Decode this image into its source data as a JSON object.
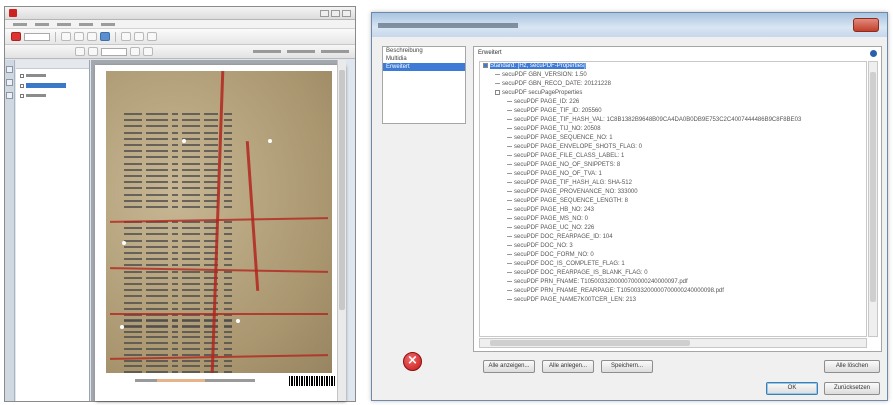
{
  "dialog": {
    "categories": [
      "Beschreibung",
      "Multidia",
      "Erweitert"
    ],
    "selected_category": "Erweitert",
    "panel_title": "Erweitert",
    "tree": [
      {
        "text": "Standard: [Hz, secuPDF-Properties]",
        "level": 0,
        "expander": true,
        "selected": true
      },
      {
        "text": "secuPDF GBN_VERSION: 1.50",
        "level": 1
      },
      {
        "text": "secuPDF GBN_RECO_DATE: 20121228",
        "level": 1
      },
      {
        "text": "secuPDF secuPageProperties",
        "level": 1,
        "expander": true
      },
      {
        "text": "secuPDF PAGE_ID: 226",
        "level": 2
      },
      {
        "text": "secuPDF PAGE_TIF_ID: 205560",
        "level": 2
      },
      {
        "text": "secuPDF PAGE_TIF_HASH_VAL: 1C8B1382B9648B09CA4DA0B0DB9E753C2C4007444486B9C8F8BE03",
        "level": 2
      },
      {
        "text": "secuPDF PAGE_TIJ_NO: 20508",
        "level": 2
      },
      {
        "text": "secuPDF PAGE_SEQUENCE_NO: 1",
        "level": 2
      },
      {
        "text": "secuPDF PAGE_ENVELOPE_SHOTS_FLAG: 0",
        "level": 2
      },
      {
        "text": "secuPDF PAGE_FILE_CLASS_LABEL: 1",
        "level": 2
      },
      {
        "text": "secuPDF PAGE_NO_OF_SNIPPETS: 8",
        "level": 2
      },
      {
        "text": "secuPDF PAGE_NO_OF_TVA: 1",
        "level": 2
      },
      {
        "text": "secuPDF PAGE_TIF_HASH_ALG: SHA-512",
        "level": 2
      },
      {
        "text": "secuPDF PAGE_PROVENANCE_NO: 333000",
        "level": 2
      },
      {
        "text": "secuPDF PAGE_SEQUENCE_LENGTH: 8",
        "level": 2
      },
      {
        "text": "secuPDF PAGE_HB_NO: 243",
        "level": 2
      },
      {
        "text": "secuPDF PAGE_MS_NO: 0",
        "level": 2
      },
      {
        "text": "secuPDF PAGE_UC_NO: 226",
        "level": 2
      },
      {
        "text": "secuPDF DOC_REARPAGE_ID: 104",
        "level": 2
      },
      {
        "text": "secuPDF DOC_NO: 3",
        "level": 2
      },
      {
        "text": "secuPDF DOC_FORM_NO: 0",
        "level": 2
      },
      {
        "text": "secuPDF DOC_IS_COMPLETE_FLAG: 1",
        "level": 2
      },
      {
        "text": "secuPDF DOC_REARPAGE_IS_BLANK_FLAG: 0",
        "level": 2
      },
      {
        "text": "secuPDF PRN_FNAME: T1050033200000700000240000097.pdf",
        "level": 2
      },
      {
        "text": "secuPDF PRN_FNAME_REARPAGE: T1050033200000700000240000098.pdf",
        "level": 2
      },
      {
        "text": "secuPDF PAGE_NAME7K00TCER_LEN: 213",
        "level": 2
      }
    ],
    "buttons": {
      "expand_all": "Alle anzeigen...",
      "collapse_all": "Alle anlegen...",
      "save": "Speichern...",
      "delete_all": "Alle löschen",
      "ok": "OK",
      "cancel": "Zurücksetzen"
    }
  }
}
